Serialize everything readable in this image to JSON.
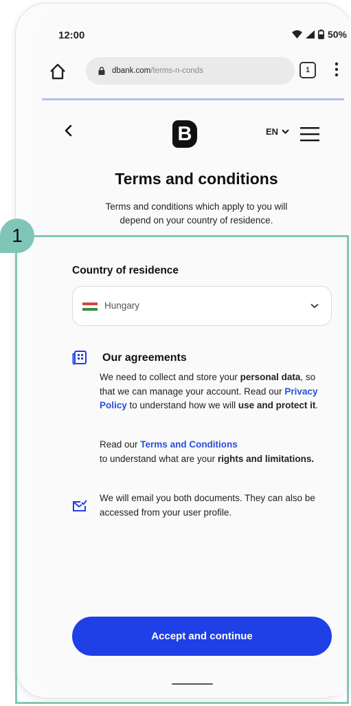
{
  "status": {
    "time": "12:00",
    "battery": "50%"
  },
  "browser": {
    "url_host": "dbank.com",
    "url_path": "/terms-n-conds",
    "tab_count": "1"
  },
  "nav": {
    "logo": "B",
    "language": "EN"
  },
  "header": {
    "title": "Terms and conditions",
    "subtitle": "Terms and conditions which apply to you will depend on your country of residence."
  },
  "form": {
    "country_label": "Country of residence",
    "country_value": "Hungary"
  },
  "agreements": {
    "heading": "Our agreements",
    "p1_a": "We need to collect and store your ",
    "p1_b": "personal data",
    "p1_c": ", so that we can manage your account. Read our ",
    "privacy_link": "Privacy Policy",
    "p1_d": " to understand how we will ",
    "p1_e": "use and protect it",
    "p1_f": ".",
    "p2_a": "Read our ",
    "terms_link": "Terms and Conditions",
    "p2_b": " to understand what are your ",
    "p2_c": "rights and limitations.",
    "email_note": "We will email you both documents. They can also be accessed from your user profile."
  },
  "cta": {
    "label": "Accept and continue"
  },
  "annotation": {
    "step": "1"
  },
  "colors": {
    "accent": "#1e40e6",
    "link": "#2a4fd9",
    "annotation": "#7fc6b9",
    "flag_red": "#d6453d",
    "flag_green": "#3c8a4a"
  },
  "icons": [
    "home-icon",
    "lock-icon",
    "tabs-icon",
    "more-vert-icon",
    "back-arrow-icon",
    "chevron-down-icon",
    "hamburger-menu-icon",
    "hungary-flag-icon",
    "document-icon",
    "mail-check-icon",
    "wifi-icon",
    "signal-icon",
    "battery-icon"
  ]
}
